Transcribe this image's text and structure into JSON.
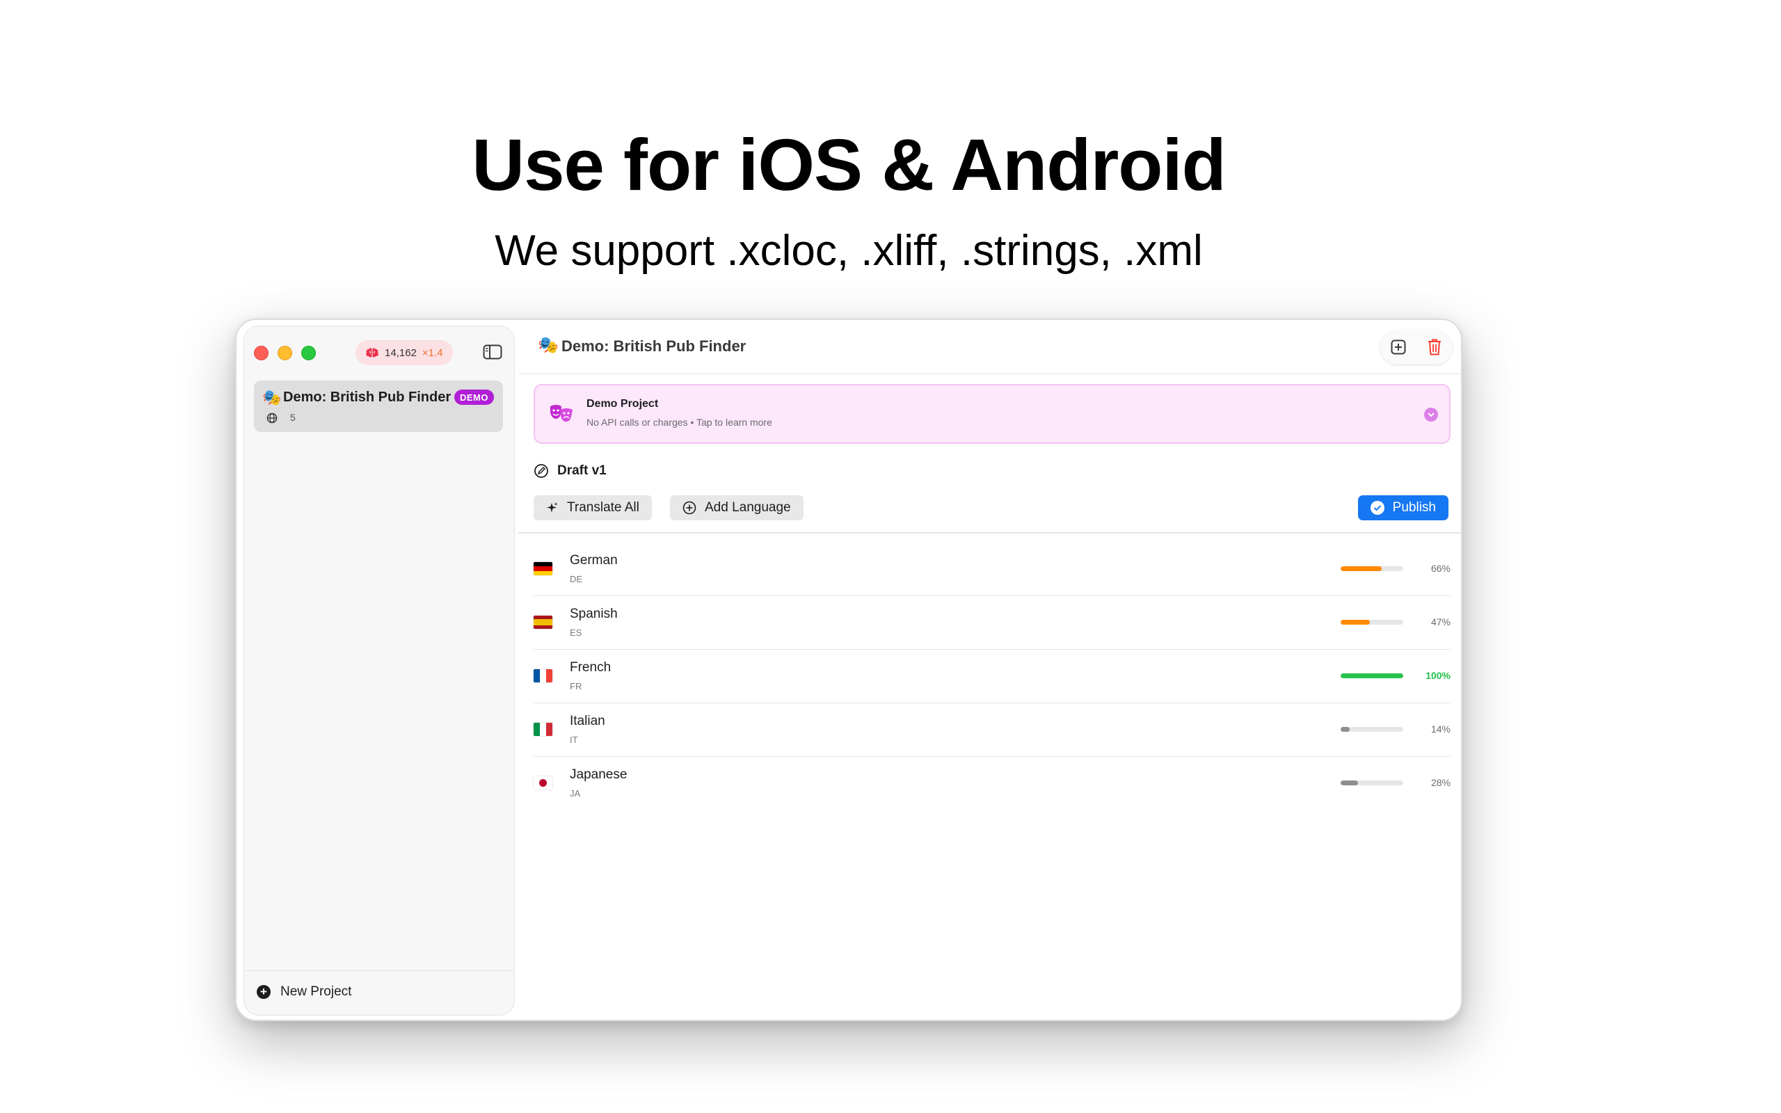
{
  "hero": {
    "title": "Use for iOS & Android",
    "subtitle": "We support .xcloc, .xliff, .strings, .xml"
  },
  "sidebar": {
    "credits": {
      "amount": "14,162",
      "multiplier": "×1.4",
      "icon": "brain-icon"
    },
    "project": {
      "emoji": "🎭",
      "name": "Demo: British Pub Finder",
      "badge": "DEMO",
      "language_count": "5"
    },
    "new_project_label": "New Project"
  },
  "main": {
    "title_emoji": "🎭",
    "title": "Demo: British Pub Finder",
    "banner": {
      "title": "Demo Project",
      "description": "No API calls or charges • Tap to learn more"
    },
    "draft_label": "Draft v1",
    "toolbar": {
      "translate_all": "Translate All",
      "add_language": "Add Language",
      "publish": "Publish"
    },
    "languages": [
      {
        "name": "German",
        "code": "DE",
        "flag": "de",
        "progress": 66,
        "percent_label": "66%",
        "color": "#ff8a00"
      },
      {
        "name": "Spanish",
        "code": "ES",
        "flag": "es",
        "progress": 47,
        "percent_label": "47%",
        "color": "#ff8a00"
      },
      {
        "name": "French",
        "code": "FR",
        "flag": "fr",
        "progress": 100,
        "percent_label": "100%",
        "color": "#27c24c"
      },
      {
        "name": "Italian",
        "code": "IT",
        "flag": "it",
        "progress": 14,
        "percent_label": "14%",
        "color": "#8e8e8e"
      },
      {
        "name": "Japanese",
        "code": "JA",
        "flag": "jp",
        "progress": 28,
        "percent_label": "28%",
        "color": "#8e8e8e"
      }
    ]
  },
  "colors": {
    "accent_blue": "#1677f2",
    "demo_badge": "#b01fd6",
    "banner_bg": "#fce7fb",
    "delete_red": "#ff3b30"
  }
}
